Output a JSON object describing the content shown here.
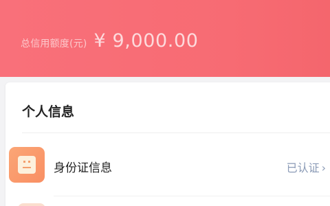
{
  "credit": {
    "label": "总信用额度(元)",
    "amount": "¥ 9,000.00"
  },
  "personal_info": {
    "title": "个人信息",
    "items": [
      {
        "label": "身份证信息",
        "status": "已认证",
        "icon": "id-card-icon"
      }
    ]
  },
  "colors": {
    "banner": "#f76b73",
    "status_text": "#8a9ab6",
    "icon_bg": "#f98f63"
  }
}
